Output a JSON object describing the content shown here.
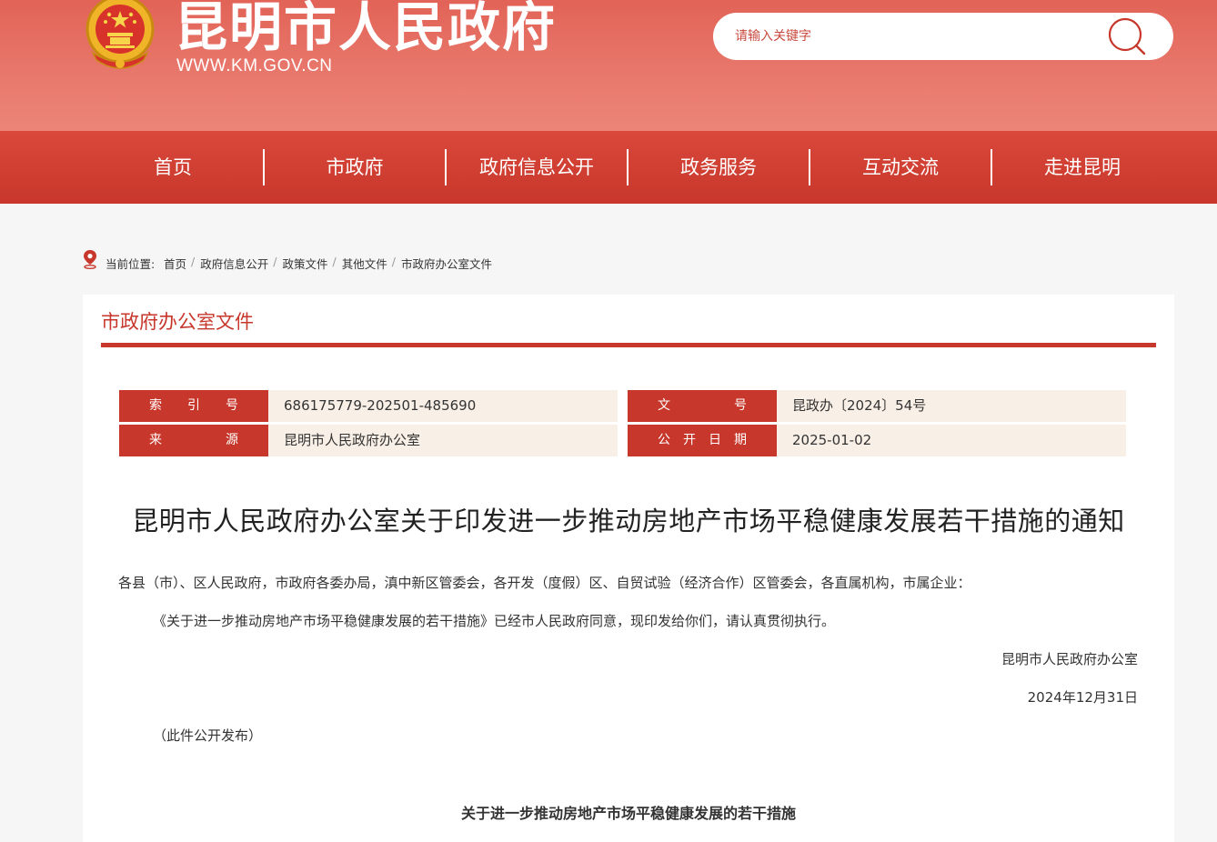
{
  "header": {
    "title": "昆明市人民政府",
    "url": "WWW.KM.GOV.CN",
    "search_placeholder": "请输入关键字"
  },
  "nav": {
    "items": [
      "首页",
      "市政府",
      "政府信息公开",
      "政务服务",
      "互动交流",
      "走进昆明"
    ]
  },
  "breadcrumb": {
    "label": "当前位置:",
    "items": [
      "首页",
      "政府信息公开",
      "政策文件",
      "其他文件",
      "市政府办公室文件"
    ]
  },
  "panel": {
    "title": "市政府办公室文件"
  },
  "meta": {
    "index_label": "索　　引　　号",
    "index_value": "686175779-202501-485690",
    "docno_label": "文　　　　　号",
    "docno_value": "昆政办〔2024〕54号",
    "source_label": "来　　　　　源",
    "source_value": "昆明市人民政府办公室",
    "date_label": "公　开　日　期",
    "date_value": "2025-01-02"
  },
  "document": {
    "title": "昆明市人民政府办公室关于印发进一步推动房地产市场平稳健康发展若干措施的通知",
    "salutation": "各县（市）、区人民政府，市政府各委办局，滇中新区管委会，各开发（度假）区、自贸试验（经济合作）区管委会，各直属机构，市属企业：",
    "body": "《关于进一步推动房地产市场平稳健康发展的若干措施》已经市人民政府同意，现印发给你们，请认真贯彻执行。",
    "signature": "昆明市人民政府办公室",
    "date": "2024年12月31日",
    "note": "（此件公开发布）",
    "subtitle": "关于进一步推动房地产市场平稳健康发展的若干措施"
  },
  "colors": {
    "brand_red": "#c8372b",
    "header_red": "#e26357",
    "meta_bg": "#f8efe6",
    "emblem_gold": "#f4c430"
  }
}
